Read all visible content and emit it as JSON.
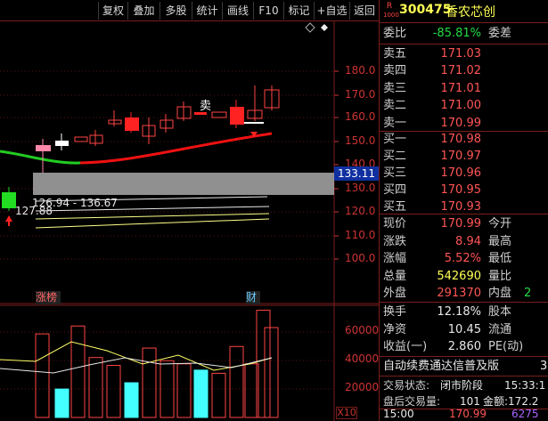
{
  "toolbar": {
    "buttons": [
      "复权",
      "叠加",
      "多股",
      "统计",
      "画线",
      "F10",
      "标记",
      "+自选",
      "返回"
    ]
  },
  "chart": {
    "y_ticks": [
      "180.0",
      "170.0",
      "160.0",
      "150.0",
      "140.0",
      "130.0",
      "120.0",
      "110.0",
      "100.0"
    ],
    "current_price_label": "133.11",
    "range_label": "126.94 - 136.67",
    "low_marker_label": "127.88",
    "sell_marker": "卖",
    "tag_zhangbang": "涨榜",
    "tag_cai": "财",
    "vol_ticks": [
      "60000",
      "40000",
      "20000"
    ],
    "vol_unit": "X10",
    "diamond_icon": "diamond-outline"
  },
  "chart_data": {
    "type": "bar",
    "categories": [
      "1",
      "2",
      "3",
      "4",
      "5",
      "6",
      "7",
      "8",
      "9",
      "10",
      "11",
      "12",
      "13",
      "14",
      "15"
    ],
    "series": [
      {
        "values": [
          53000,
          18000,
          58000,
          38000,
          33000,
          22000,
          44000,
          36000,
          34000,
          30000,
          28000,
          45000,
          34000,
          68000,
          57000
        ]
      }
    ],
    "ylim": [
      0,
      70000
    ]
  },
  "panel": {
    "badge": "R",
    "badge_sub": "1000",
    "code": "300475",
    "name": "香农芯创",
    "weibi_label": "委比",
    "weibi_value": "-85.81%",
    "weicha_label": "委差",
    "sells": [
      {
        "label": "卖五",
        "price": "171.03"
      },
      {
        "label": "卖四",
        "price": "171.02"
      },
      {
        "label": "卖三",
        "price": "171.01"
      },
      {
        "label": "卖二",
        "price": "171.00"
      },
      {
        "label": "卖一",
        "price": "170.99"
      }
    ],
    "buys": [
      {
        "label": "买一",
        "price": "170.98"
      },
      {
        "label": "买二",
        "price": "170.97"
      },
      {
        "label": "买三",
        "price": "170.96"
      },
      {
        "label": "买四",
        "price": "170.95"
      },
      {
        "label": "买五",
        "price": "170.93"
      }
    ],
    "stats": [
      {
        "l1": "现价",
        "v1": "170.99",
        "l2": "今开",
        "v2": ""
      },
      {
        "l1": "涨跌",
        "v1": "8.94",
        "l2": "最高",
        "v2": ""
      },
      {
        "l1": "涨幅",
        "v1": "5.52%",
        "l2": "最低",
        "v2": ""
      },
      {
        "l1": "总量",
        "v1": "542690",
        "l2": "量比",
        "v2": ""
      },
      {
        "l1": "外盘",
        "v1": "291370",
        "l2": "内盘",
        "v2": "2"
      }
    ],
    "stats2": [
      {
        "l1": "换手",
        "v1": "12.18%",
        "l2": "股本",
        "v2": ""
      },
      {
        "l1": "净资",
        "v1": "10.45",
        "l2": "流通",
        "v2": ""
      },
      {
        "l1": "收益(一)",
        "v1": "2.860",
        "l2": "PE(动)",
        "v2": ""
      }
    ],
    "ad_text": "自动续费通达信普及版",
    "ad_tail": "30",
    "status_label": "交易状态:",
    "status_value": "闭市阶段",
    "status_time": "15:33:1",
    "after_label": "盘后交易量:",
    "after_value": "101",
    "after_extra": "金额:172.2",
    "last_time": "15:00",
    "last_price": "170.99",
    "last_vol": "6275"
  }
}
